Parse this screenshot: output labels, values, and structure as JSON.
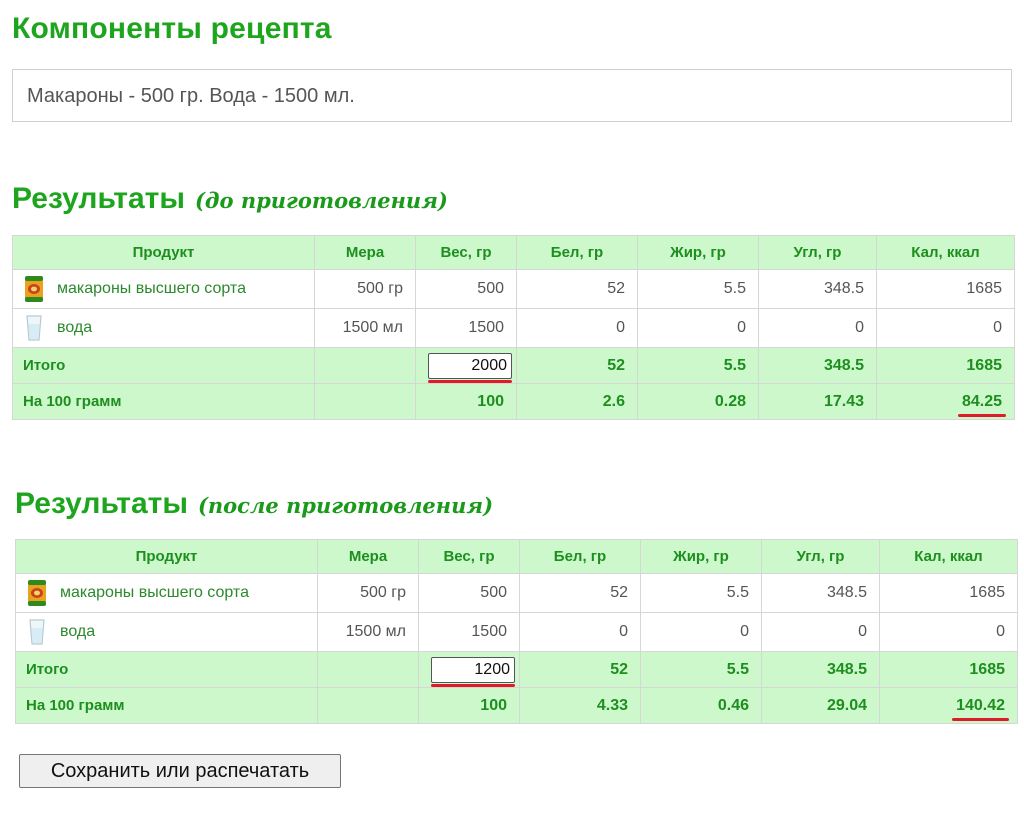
{
  "page_title": "Компоненты рецепта",
  "recipe_text": "Макароны - 500 гр. Вода - 1500 мл.",
  "columns": [
    "Продукт",
    "Мера",
    "Вес, гр",
    "Бел, гр",
    "Жир, гр",
    "Угл, гр",
    "Кал, ккал"
  ],
  "sections": [
    {
      "title": "Результаты",
      "note": "(до приготовления)",
      "rows": [
        {
          "product": "макароны высшего сорта",
          "icon": "pasta-pack-icon",
          "measure": "500 гр",
          "weight": "500",
          "protein": "52",
          "fat": "5.5",
          "carbs": "348.5",
          "kcal": "1685"
        },
        {
          "product": "вода",
          "icon": "water-glass-icon",
          "measure": "1500 мл",
          "weight": "1500",
          "protein": "0",
          "fat": "0",
          "carbs": "0",
          "kcal": "0"
        }
      ],
      "total": {
        "label": "Итого",
        "weight": "2000",
        "protein": "52",
        "fat": "5.5",
        "carbs": "348.5",
        "kcal": "1685"
      },
      "per100": {
        "label": "На 100 грамм",
        "weight": "100",
        "protein": "2.6",
        "fat": "0.28",
        "carbs": "17.43",
        "kcal": "84.25"
      }
    },
    {
      "title": "Результаты",
      "note": "(после приготовления)",
      "rows": [
        {
          "product": "макароны высшего сорта",
          "icon": "pasta-pack-icon",
          "measure": "500 гр",
          "weight": "500",
          "protein": "52",
          "fat": "5.5",
          "carbs": "348.5",
          "kcal": "1685"
        },
        {
          "product": "вода",
          "icon": "water-glass-icon",
          "measure": "1500 мл",
          "weight": "1500",
          "protein": "0",
          "fat": "0",
          "carbs": "0",
          "kcal": "0"
        }
      ],
      "total": {
        "label": "Итого",
        "weight": "1200",
        "protein": "52",
        "fat": "5.5",
        "carbs": "348.5",
        "kcal": "1685"
      },
      "per100": {
        "label": "На 100 грамм",
        "weight": "100",
        "protein": "4.33",
        "fat": "0.46",
        "carbs": "29.04",
        "kcal": "140.42"
      }
    }
  ],
  "save_button_label": "Сохранить или распечатать",
  "colors": {
    "accent_green": "#1ea51e",
    "header_bg": "#ccf8cc",
    "highlight_red": "#dd1c2a"
  }
}
